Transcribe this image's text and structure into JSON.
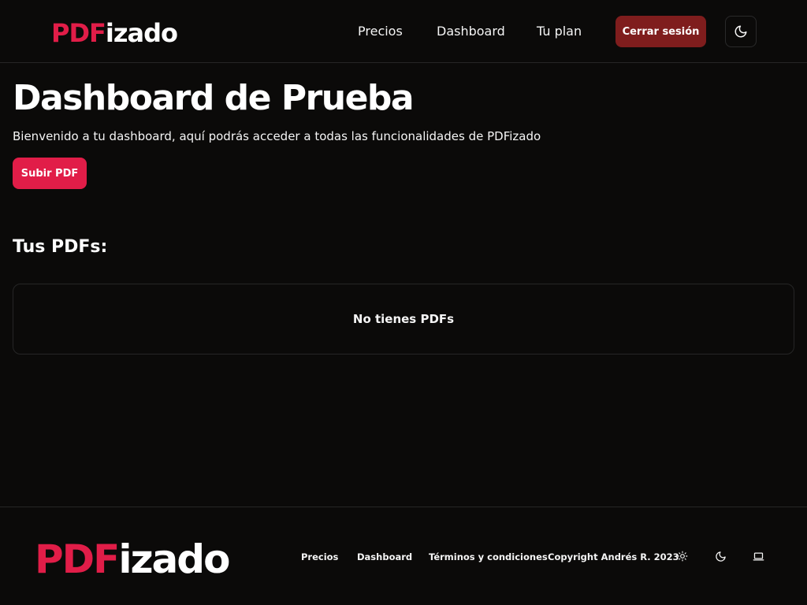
{
  "header": {
    "logo": {
      "accent": "PDF",
      "rest": "izado"
    },
    "nav": {
      "precios": "Precios",
      "dashboard": "Dashboard",
      "plan": "Tu plan"
    },
    "logout_label": "Cerrar sesión",
    "theme_icon": "moon-icon"
  },
  "main": {
    "title": "Dashboard de Prueba",
    "welcome": "Bienvenido a tu dashboard, aquí podrás acceder a todas las funcionalidades de PDFizado",
    "upload_label": "Subir PDF",
    "section_title": "Tus PDFs:",
    "empty_message": "No tienes PDFs"
  },
  "footer": {
    "logo": {
      "accent": "PDF",
      "rest": "izado"
    },
    "links": {
      "precios": "Precios",
      "dashboard": "Dashboard",
      "terminos": "Términos y condiciones"
    },
    "copyright": "Copyright Andrés R. 2023",
    "theme_icons": [
      "sun-icon",
      "moon-icon",
      "laptop-icon"
    ]
  },
  "colors": {
    "background": "#0b0a09",
    "accent": "#e11d48",
    "logout": "#7f1d1d",
    "border": "#262626"
  }
}
